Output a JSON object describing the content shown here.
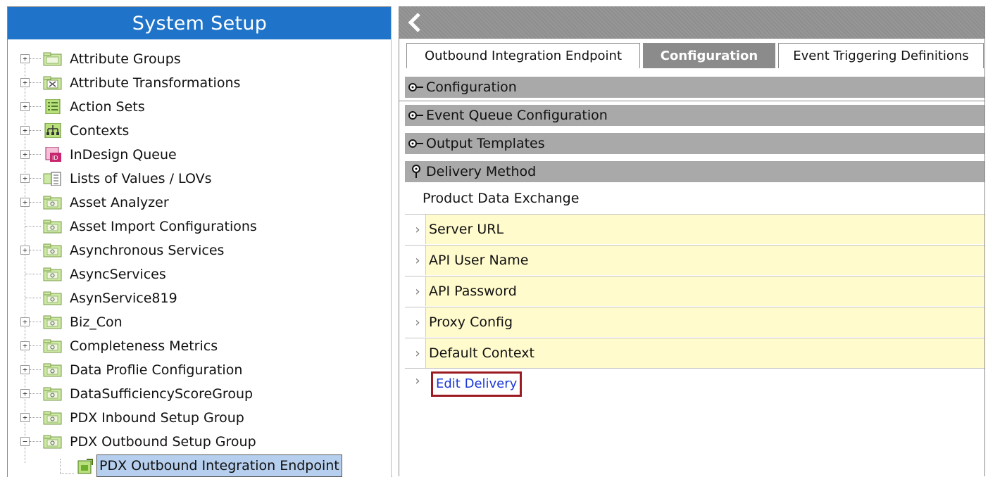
{
  "left_panel": {
    "title": "System Setup",
    "tree": [
      {
        "label": "Attribute Groups",
        "expander": "+",
        "icon": "folder-icon"
      },
      {
        "label": "Attribute Transformations",
        "expander": "+",
        "icon": "transform-folder-icon"
      },
      {
        "label": "Action Sets",
        "expander": "+",
        "icon": "action-set-icon"
      },
      {
        "label": "Contexts",
        "expander": "+",
        "icon": "contexts-icon"
      },
      {
        "label": "InDesign Queue",
        "expander": "+",
        "icon": "indesign-icon"
      },
      {
        "label": "Lists of Values / LOVs",
        "expander": "+",
        "icon": "lov-icon"
      },
      {
        "label": "Asset Analyzer",
        "expander": "+",
        "icon": "folder-icon"
      },
      {
        "label": "Asset Import Configurations",
        "expander": "",
        "icon": "folder-icon"
      },
      {
        "label": "Asynchronous Services",
        "expander": "+",
        "icon": "folder-icon"
      },
      {
        "label": "AsyncServices",
        "expander": "",
        "icon": "folder-icon"
      },
      {
        "label": "AsynService819",
        "expander": "",
        "icon": "folder-icon"
      },
      {
        "label": "Biz_Con",
        "expander": "+",
        "icon": "folder-icon"
      },
      {
        "label": "Completeness Metrics",
        "expander": "+",
        "icon": "folder-icon"
      },
      {
        "label": "Data Proflie Configuration",
        "expander": "+",
        "icon": "folder-icon"
      },
      {
        "label": "DataSufficiencyScoreGroup",
        "expander": "+",
        "icon": "folder-icon"
      },
      {
        "label": "PDX Inbound Setup Group",
        "expander": "+",
        "icon": "folder-icon"
      },
      {
        "label": "PDX Outbound Setup Group",
        "expander": "−",
        "icon": "folder-icon"
      },
      {
        "label": "PDX Outbound Integration Endpoint",
        "expander": "",
        "icon": "endpoint-icon",
        "selected": true
      }
    ]
  },
  "right_panel": {
    "back_icon": "chevron-left-icon",
    "tabs": [
      {
        "label": "Outbound Integration Endpoint",
        "active": false
      },
      {
        "label": "Configuration",
        "active": true
      },
      {
        "label": "Event Triggering Definitions",
        "active": false
      }
    ],
    "sections": [
      {
        "label": "Configuration",
        "icon": "collapsed-pin-icon"
      },
      {
        "label": "Event Queue Configuration",
        "icon": "collapsed-pin-icon"
      },
      {
        "label": "Output Templates",
        "icon": "collapsed-pin-icon"
      },
      {
        "label": "Delivery Method",
        "icon": "expanded-pin-icon"
      }
    ],
    "delivery_method_value": "Product Data Exchange",
    "properties": [
      {
        "label": "Server URL"
      },
      {
        "label": "API User Name"
      },
      {
        "label": "API Password"
      },
      {
        "label": "Proxy Config"
      },
      {
        "label": "Default Context"
      }
    ],
    "edit_link": "Edit Delivery"
  },
  "colors": {
    "header_blue": "#1f74c9",
    "section_gray": "#a9a9a9",
    "property_yellow": "#fffbcd",
    "link_blue": "#1a37d6",
    "highlight_red": "#9b1b22",
    "selection_blue": "#b6cfee"
  }
}
